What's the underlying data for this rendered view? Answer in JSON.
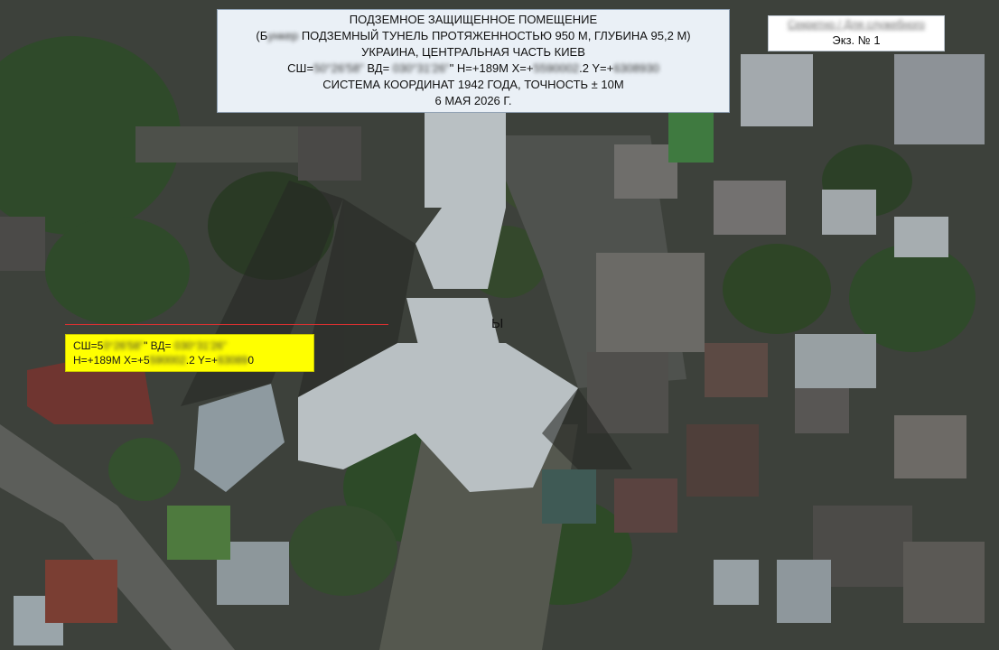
{
  "title_block": {
    "line1": "ПОДЗЕМНОЕ ЗАЩИЩЕННОЕ ПОМЕЩЕНИЕ",
    "line2_prefix": "(Б",
    "line2_hidden": "ункер",
    "line2_rest": " ПОДЗЕМНЫЙ ТУНЕЛЬ ПРОТЯЖЕННОСТЬЮ 950 М, ГЛУБИНА 95,2 М)",
    "line3": "УКРАИНА, ЦЕНТРАЛЬНАЯ ЧАСТЬ КИЕВ",
    "line4_a": "СШ=",
    "line4_hidden1": "50°26'58\"",
    "line4_b": " ВД= ",
    "line4_hidden2": "030°31'26\"",
    "line4_c": "\" H=+189М X=+",
    "line4_hidden3": "5590002",
    "line4_d": ".2 Y=+",
    "line4_hidden4": "6308930",
    "line5": "СИСТЕМА КООРДИНАТ 1942 ГОДА, ТОЧНОСТЬ ± 10М",
    "line6": "6 МАЯ 2026 Г."
  },
  "copy_block": {
    "stamp_text": "Секретно / Для служебного",
    "copy_label": "Экз. № 1"
  },
  "coord_label": {
    "line1_a": "СШ=5",
    "line1_hidden1": "0°26'58\"",
    "line1_b": "\" ВД= ",
    "line1_hidden2": "030°31'26\"",
    "line2_a": "H=+189М X=+5",
    "line2_hidden1": "590002",
    "line2_b": ".2 Y=+",
    "line2_hidden2": "63089",
    "line2_c": "0"
  },
  "map_mark": "Ы",
  "colors": {
    "title_bg": "#eaf0f6",
    "label_bg": "#ffff00",
    "pointer": "#e03030"
  }
}
